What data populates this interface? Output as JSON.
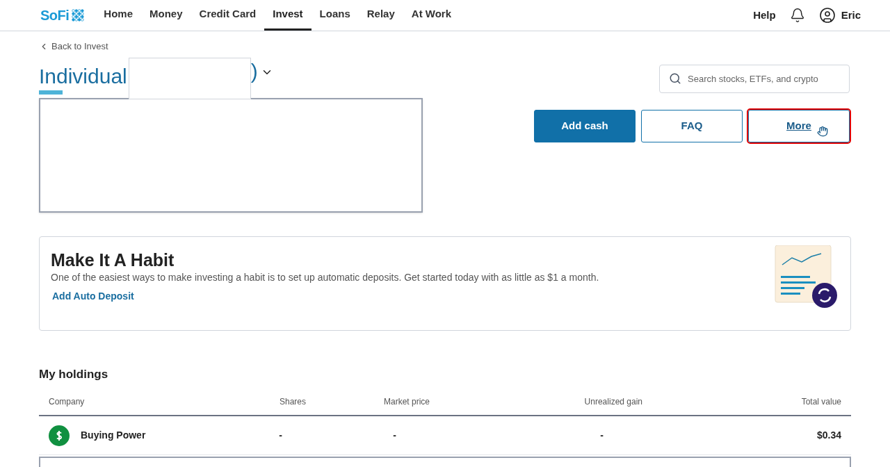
{
  "logo": "SoFi",
  "nav": [
    {
      "label": "Home",
      "selected": false
    },
    {
      "label": "Money",
      "selected": false
    },
    {
      "label": "Credit Card",
      "selected": false
    },
    {
      "label": "Invest",
      "selected": true
    },
    {
      "label": "Loans",
      "selected": false
    },
    {
      "label": "Relay",
      "selected": false
    },
    {
      "label": "At Work",
      "selected": false
    }
  ],
  "header_right": {
    "help": "Help",
    "user": "Eric"
  },
  "back_link": "Back to Invest",
  "account": {
    "title": "Individual",
    "title_tail": ")"
  },
  "search": {
    "placeholder": "Search stocks, ETFs, and crypto"
  },
  "actions": [
    {
      "label": "Add cash",
      "kind": "primary"
    },
    {
      "label": "FAQ",
      "kind": "outline"
    },
    {
      "label": "More",
      "kind": "highlighted"
    }
  ],
  "habit_card": {
    "title": "Make It A Habit",
    "text": "One of the easiest ways to make investing a habit is to set up automatic deposits. Get started today with as little as $1 a month.",
    "link": "Add Auto Deposit"
  },
  "holdings": {
    "title": "My holdings",
    "columns": [
      "Company",
      "Shares",
      "Market price",
      "Unrealized gain",
      "Total value"
    ],
    "rows": [
      {
        "company": "Buying Power",
        "shares": "-",
        "market_price": "-",
        "unrealized_gain": "-",
        "total_value": "$0.34"
      }
    ]
  }
}
